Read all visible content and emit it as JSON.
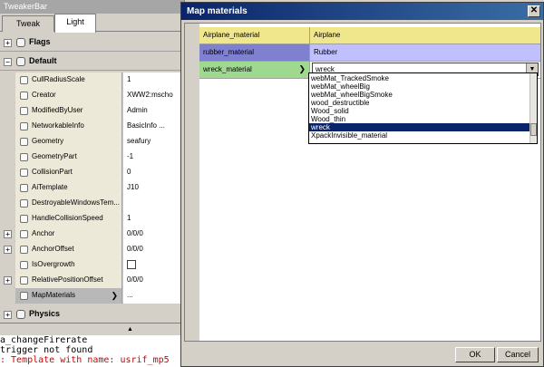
{
  "tweaker": {
    "title": "TweakerBar",
    "tabs": [
      {
        "label": "Tweak"
      },
      {
        "label": "Light"
      }
    ],
    "groups": {
      "flags": "Flags",
      "default": "Default",
      "physics": "Physics"
    },
    "properties": [
      {
        "name": "CullRadiusScale",
        "value": "1"
      },
      {
        "name": "Creator",
        "value": "XWW2:mscho"
      },
      {
        "name": "ModifiedByUser",
        "value": "Admin"
      },
      {
        "name": "NetworkableInfo",
        "value": "BasicInfo ..."
      },
      {
        "name": "Geometry",
        "value": "seafury"
      },
      {
        "name": "GeometryPart",
        "value": "-1"
      },
      {
        "name": "CollisionPart",
        "value": "0"
      },
      {
        "name": "AiTemplate",
        "value": "J10"
      },
      {
        "name": "DestroyableWindowsTem...",
        "value": ""
      },
      {
        "name": "HandleCollisionSpeed",
        "value": "1"
      },
      {
        "name": "Anchor",
        "value": "0/0/0"
      },
      {
        "name": "AnchorOffset",
        "value": "0/0/0"
      },
      {
        "name": "IsOvergrowth",
        "value": ""
      },
      {
        "name": "RelativePositionOffset",
        "value": "0/0/0"
      },
      {
        "name": "MapMaterials",
        "value": "..."
      }
    ]
  },
  "console": {
    "lines": [
      "a_changeFirerate",
      "trigger not found",
      ": Template with name: usrif_mp5"
    ]
  },
  "dialog": {
    "title": "Map materials",
    "close_glyph": "✕",
    "header": {
      "left": "Airplane_material",
      "right": "Airplane"
    },
    "rubber_row": {
      "left": "rubber_material",
      "right": "Rubber"
    },
    "wreck_row": {
      "left": "wreck_material",
      "right": "wreck"
    },
    "dropdown_options": [
      "webMat_TrackedSmoke",
      "webMat_wheelBig",
      "webMat_wheelBigSmoke",
      "wood_destructible",
      "Wood_solid",
      "Wood_thin",
      "wreck",
      "XpackInvisible_material"
    ],
    "selected_option": "wreck",
    "ok_label": "OK",
    "cancel_label": "Cancel"
  },
  "icons": {
    "expand_plus": "+",
    "collapse_minus": "−",
    "arrow_right": "❯",
    "dropdown_arrow": "▼",
    "scroll_up": "▲"
  },
  "colors": {
    "header_cell": "#f0e68c",
    "rubber_left": "#8080d0",
    "rubber_right": "#c0c0ff",
    "wreck_left": "#9fd88f",
    "selection": "#0a246a",
    "title_bar": "#0a246a",
    "error_text": "#d00000"
  }
}
